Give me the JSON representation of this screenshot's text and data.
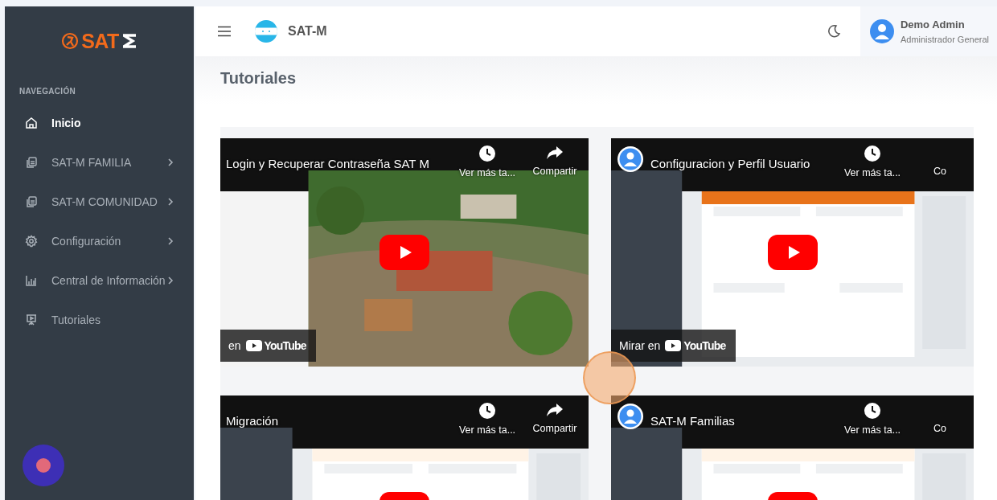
{
  "sidebar": {
    "logo": {
      "text": "SAT"
    },
    "section_title": "NAVEGACIÓN",
    "items": [
      {
        "label": "Inicio",
        "selected": true,
        "expandable": false
      },
      {
        "label": "SAT-M FAMILIA",
        "selected": false,
        "expandable": true
      },
      {
        "label": "SAT-M COMUNIDAD",
        "selected": false,
        "expandable": true
      },
      {
        "label": "Configuración",
        "selected": false,
        "expandable": true
      },
      {
        "label": "Central de Información",
        "selected": false,
        "expandable": true
      },
      {
        "label": "Tutoriales",
        "selected": false,
        "expandable": false
      }
    ]
  },
  "header": {
    "brand": "SAT-M",
    "user": {
      "name": "Demo Admin",
      "role": "Administrador General"
    }
  },
  "page_title": "Tutoriales",
  "videos": [
    {
      "title": "Login y Recuperar Contraseña SAT M",
      "channel_avatar": false,
      "actions": [
        "Ver más ta...",
        "Compartir"
      ],
      "watch_on": {
        "prefix": "en",
        "brand": "YouTube"
      }
    },
    {
      "title": "Configuracion y Perfil Usuario",
      "channel_avatar": true,
      "actions": [
        "Ver más ta...",
        "Co"
      ],
      "watch_on": {
        "prefix": "Mirar en",
        "brand": "YouTube"
      }
    },
    {
      "title": "Migración",
      "channel_avatar": false,
      "actions": [
        "Ver más ta...",
        "Compartir"
      ]
    },
    {
      "title": "SAT-M Familias",
      "channel_avatar": true,
      "actions": [
        "Ver más ta...",
        "Co"
      ]
    }
  ]
}
